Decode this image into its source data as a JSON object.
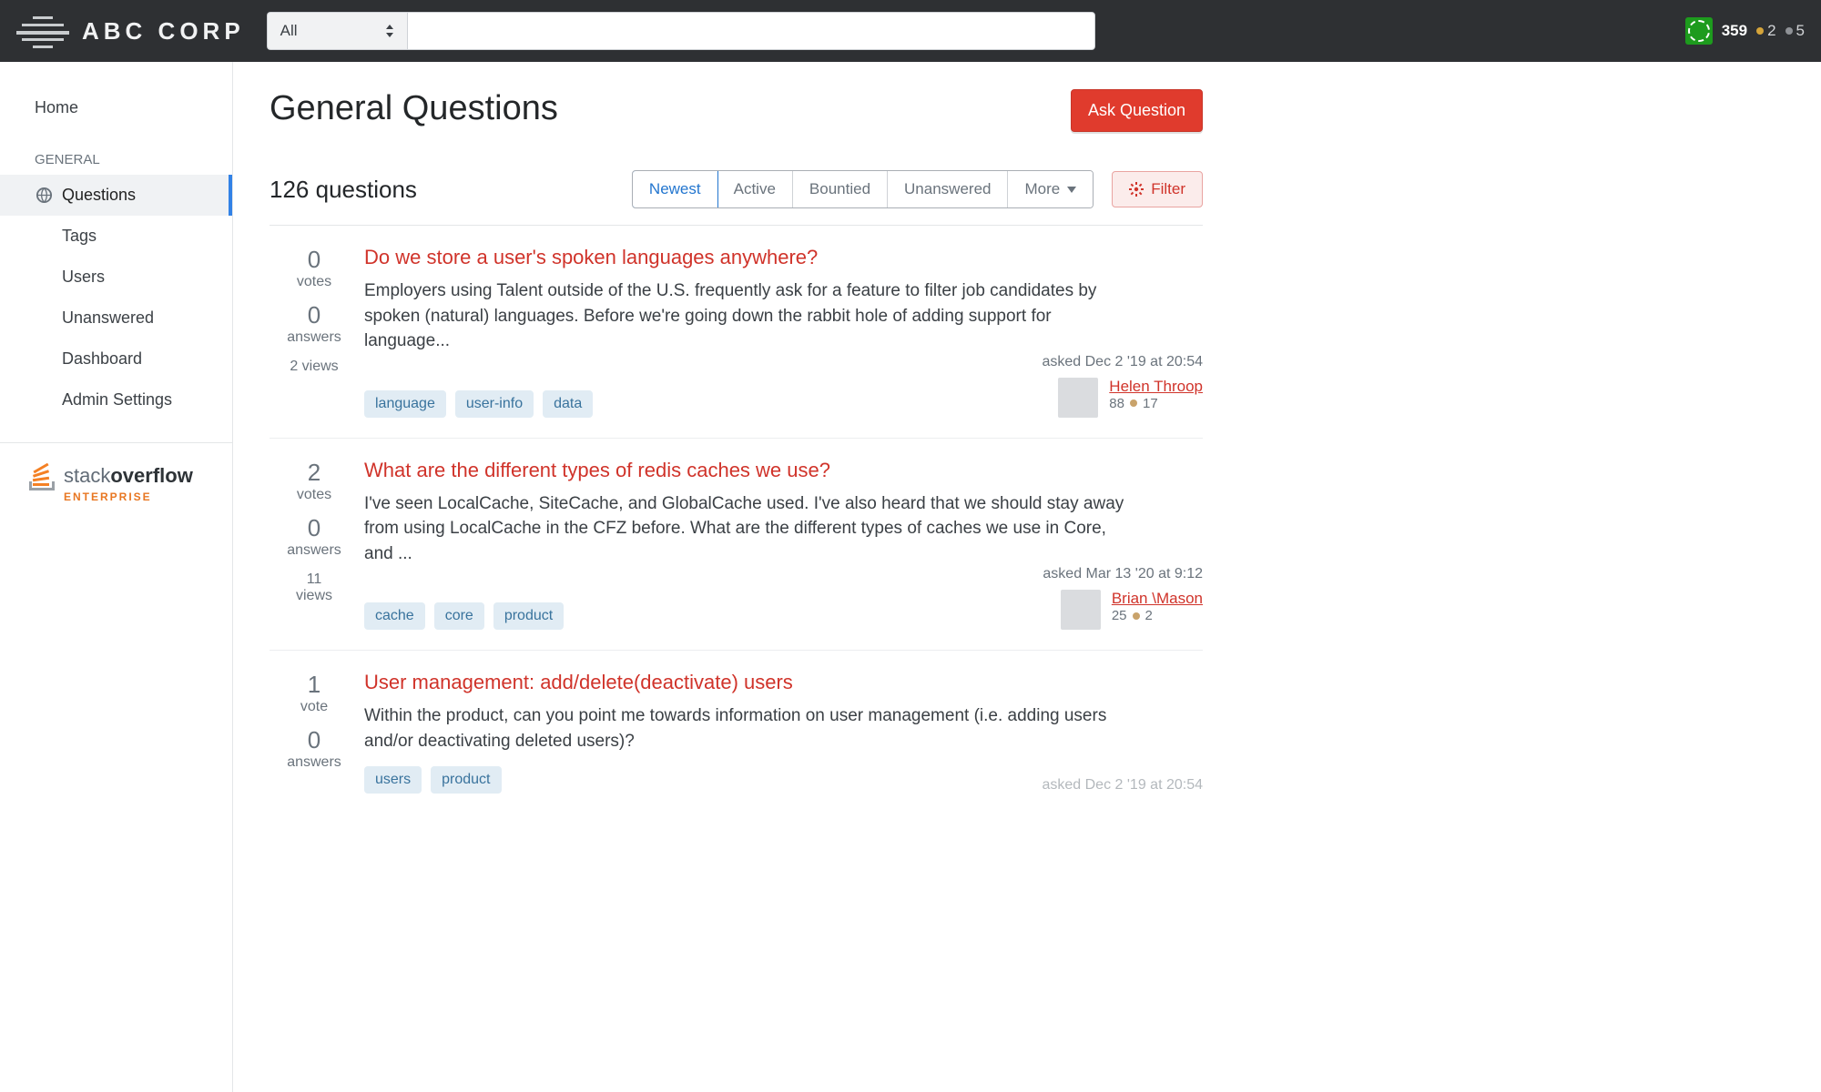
{
  "brand": {
    "name": "ABC CORP"
  },
  "search": {
    "scope": "All",
    "value": ""
  },
  "user": {
    "rep": "359",
    "gold": "2",
    "silver": "5"
  },
  "sidebar": {
    "home": "Home",
    "section": "GENERAL",
    "items": [
      {
        "label": "Questions"
      },
      {
        "label": "Tags"
      },
      {
        "label": "Users"
      },
      {
        "label": "Unanswered"
      },
      {
        "label": "Dashboard"
      },
      {
        "label": "Admin Settings"
      }
    ],
    "so": {
      "word1": "stack",
      "word2": "overflow",
      "sub": "ENTERPRISE"
    }
  },
  "page": {
    "title": "General Questions",
    "ask": "Ask Question",
    "count": "126 questions",
    "tabs": {
      "newest": "Newest",
      "active": "Active",
      "bountied": "Bountied",
      "unanswered": "Unanswered",
      "more": "More"
    },
    "filter": "Filter"
  },
  "questions": [
    {
      "votes": "0",
      "votes_lbl": "votes",
      "answers": "0",
      "answers_lbl": "answers",
      "views": "2 views",
      "title": "Do we store a user's spoken languages anywhere?",
      "excerpt": "Employers using Talent outside of the U.S. frequently ask for a feature to filter job candidates by spoken (natural) languages. Before we're going down the rabbit hole of adding support for language...",
      "tags": [
        "language",
        "user-info",
        "data"
      ],
      "asked": "asked Dec 2 '19 at 20:54",
      "author": "Helen Throop",
      "rep": "88",
      "bronze": "17"
    },
    {
      "votes": "2",
      "votes_lbl": "votes",
      "answers": "0",
      "answers_lbl": "answers",
      "views_num": "11",
      "views_word": "views",
      "title": "What are the different types of redis caches we use?",
      "excerpt": "I've seen LocalCache, SiteCache, and GlobalCache used. I've also heard that we should stay away from using LocalCache in the CFZ before. What are the different types of caches we use in Core, and ...",
      "tags": [
        "cache",
        "core",
        "product"
      ],
      "asked": "asked Mar 13 '20 at 9:12",
      "author": "Brian \\Mason",
      "rep": "25",
      "bronze": "2"
    },
    {
      "votes": "1",
      "votes_lbl": "vote",
      "answers": "0",
      "answers_lbl": "answers",
      "title": "User management: add/delete(deactivate) users",
      "excerpt": "Within the product, can you point me towards information on user management (i.e. adding users and/or deactivating deleted users)?",
      "tags": [
        "users",
        "product"
      ],
      "asked": "asked Dec 2 '19 at 20:54"
    }
  ]
}
